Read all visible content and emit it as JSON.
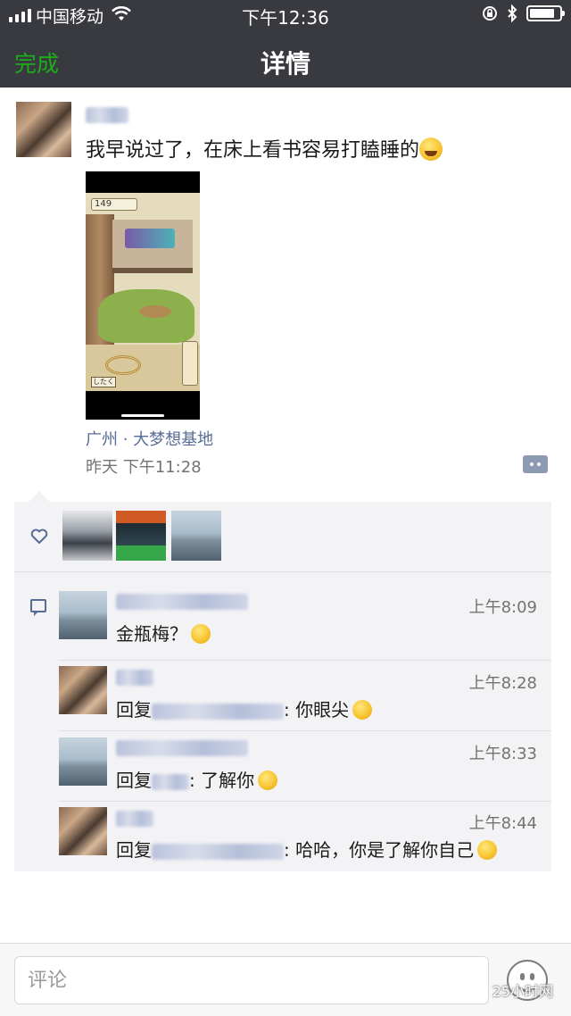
{
  "status_bar": {
    "carrier": "中国移动",
    "time": "下午12:36",
    "battery_level": 0.85
  },
  "nav": {
    "done_label": "完成",
    "title": "详情"
  },
  "post": {
    "text": "我早说过了，在床上看书容易打瞌睡的",
    "photo_counter": "149",
    "photo_button": "したく",
    "location": "广州 · 大梦想基地",
    "time": "昨天  下午11:28"
  },
  "comments": [
    {
      "time": "上午8:09",
      "prefix": "",
      "after_name": "",
      "text": "金瓶梅？"
    },
    {
      "time": "上午8:28",
      "prefix": "回复",
      "after_name": ": ",
      "text": "你眼尖"
    },
    {
      "time": "上午8:33",
      "prefix": "回复",
      "after_name": ": ",
      "text": "了解你"
    },
    {
      "time": "上午8:44",
      "prefix": "回复",
      "after_name": ": ",
      "text": "哈哈，你是了解你自己"
    }
  ],
  "input": {
    "placeholder": "评论"
  },
  "watermark": "25小时网",
  "colors": {
    "nav_bg": "#393a3f",
    "accent_green": "#1aad19",
    "link_blue": "#576b95",
    "panel_bg": "#f3f3f5"
  },
  "icons": {
    "like": "heart-outline-icon",
    "comment": "comment-bubble-icon",
    "more": "more-dots-icon",
    "emoji": "smiley-face-icon"
  }
}
